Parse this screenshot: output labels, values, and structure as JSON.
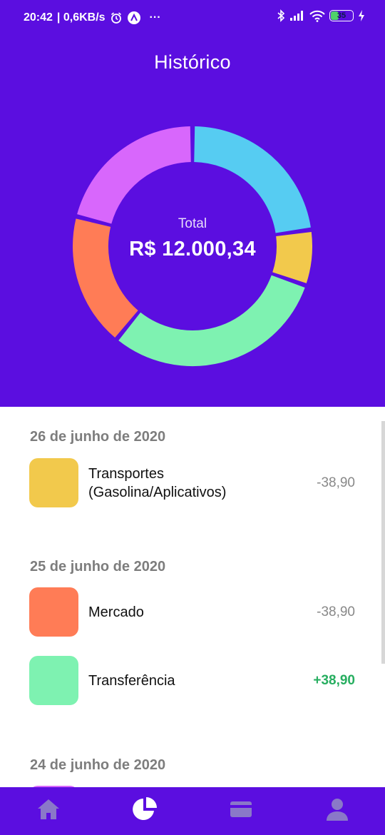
{
  "status_bar": {
    "time": "20:42",
    "network_speed": "| 0,6KB/s",
    "more": "···",
    "battery_percent": 35,
    "battery_label": "35",
    "icons": [
      "alarm-icon",
      "app-notification-icon",
      "bluetooth-icon",
      "signal-icon",
      "wifi-icon",
      "battery-icon",
      "charging-icon"
    ]
  },
  "header": {
    "title": "Histórico"
  },
  "summary": {
    "total_label": "Total",
    "total_value": "R$ 12.000,34"
  },
  "chart_data": {
    "type": "pie",
    "title": "",
    "segments": [
      {
        "color": "#56ccf2",
        "fraction": 0.228
      },
      {
        "color": "#f2c94c",
        "fraction": 0.075
      },
      {
        "color": "#7ef2b1",
        "fraction": 0.306
      },
      {
        "color": "#ff7c56",
        "fraction": 0.181
      },
      {
        "color": "#d867fc",
        "fraction": 0.21
      }
    ]
  },
  "transactions": [
    {
      "date": "26 de junho de 2020",
      "items": [
        {
          "label_line1": "Transportes",
          "label_line2": "(Gasolina/Aplicativos)",
          "amount": "-38,90",
          "color": "#f2c94c",
          "positive": false
        }
      ]
    },
    {
      "date": "25 de junho de 2020",
      "items": [
        {
          "label_line1": "Mercado",
          "label_line2": "",
          "amount": "-38,90",
          "color": "#ff7c56",
          "positive": false
        },
        {
          "label_line1": "Transferência",
          "label_line2": "",
          "amount": "+38,90",
          "color": "#7ef2b1",
          "positive": true
        }
      ]
    },
    {
      "date": "24 de junho de 2020",
      "items": [
        {
          "label_line1": "",
          "label_line2": "",
          "amount": "",
          "color": "#d867fc",
          "positive": false
        }
      ]
    }
  ],
  "bottom_nav": [
    {
      "icon": "home-icon",
      "active": false
    },
    {
      "icon": "pie-chart-icon",
      "active": true
    },
    {
      "icon": "credit-card-icon",
      "active": false
    },
    {
      "icon": "profile-icon",
      "active": false
    }
  ],
  "colors": {
    "primary": "#5b0ee0",
    "positive": "#27ae60",
    "muted": "#888888"
  }
}
